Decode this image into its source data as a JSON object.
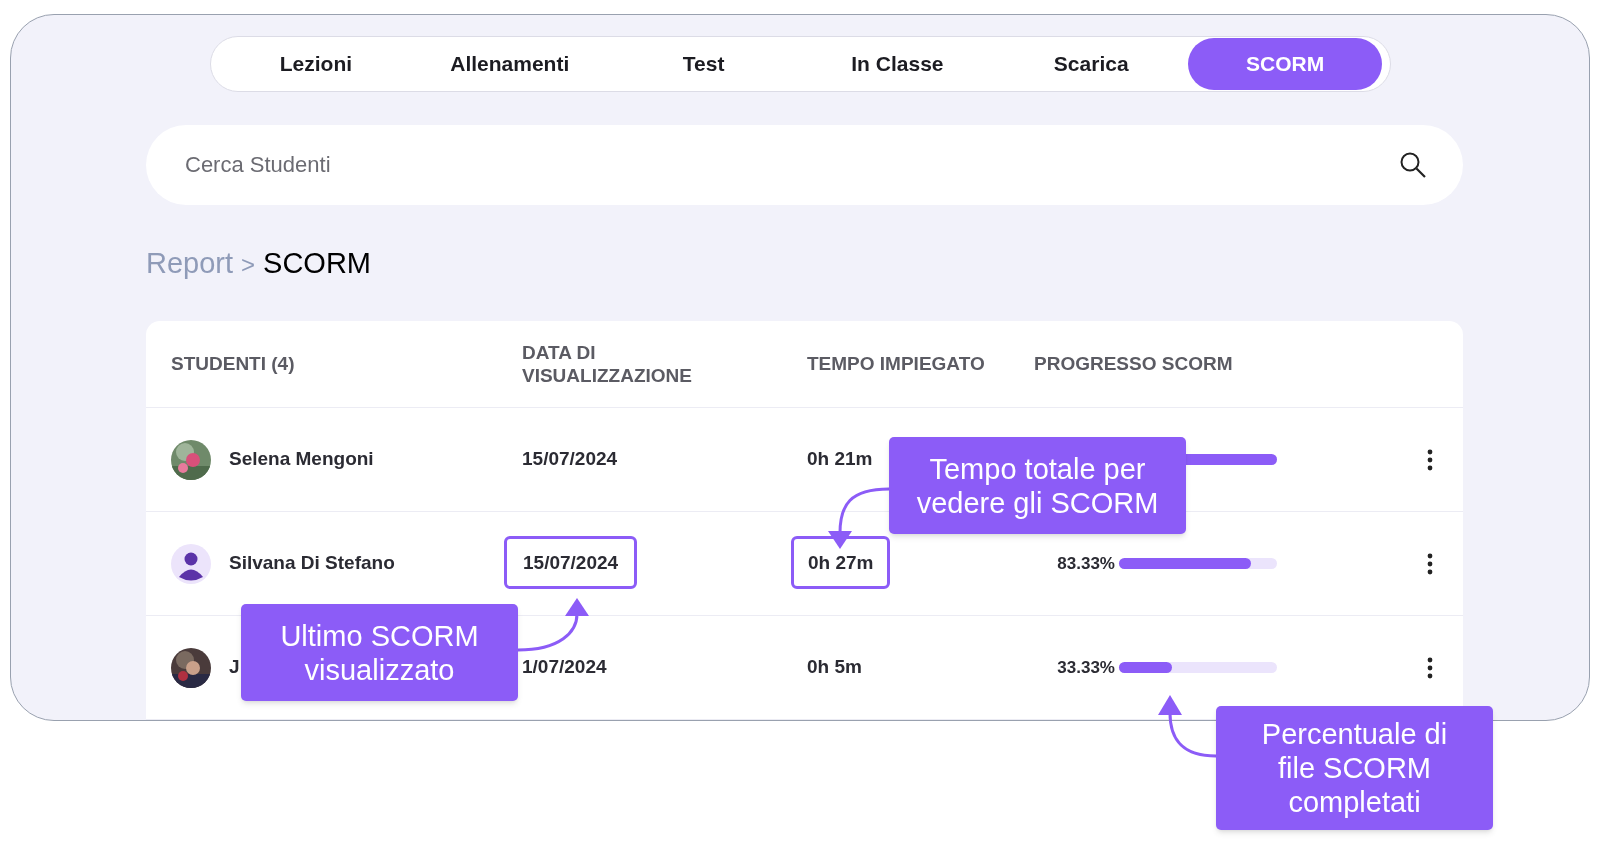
{
  "tabs": [
    {
      "label": "Lezioni",
      "selected": false
    },
    {
      "label": "Allenamenti",
      "selected": false
    },
    {
      "label": "Test",
      "selected": false
    },
    {
      "label": "In Classe",
      "selected": false
    },
    {
      "label": "Scarica",
      "selected": false
    },
    {
      "label": "SCORM",
      "selected": true
    }
  ],
  "search": {
    "placeholder": "Cerca Studenti"
  },
  "breadcrumb": {
    "parent": "Report",
    "separator": ">",
    "current": "SCORM"
  },
  "table": {
    "columns": [
      "STUDENTI (4)",
      "DATA DI VISUALIZZAZIONE",
      "TEMPO IMPIEGATO",
      "PROGRESSO SCORM"
    ],
    "rows": [
      {
        "name": "Selena Mengoni",
        "date": "15/07/2024",
        "date_highlighted": false,
        "time": "0h 21m",
        "time_highlighted": false,
        "level": 1
      },
      {
        "kind": "silhouette",
        "name": "Silvana Di Stefano",
        "date": "15/07/2024",
        "date_highlighted": true,
        "time": "0h 27m",
        "time_highlighted": true,
        "percent": "83.33%",
        "level": 0.8333
      },
      {
        "name": "J",
        "date": "1/07/2024",
        "date_highlighted": false,
        "time": "0h 5m",
        "time_highlighted": false,
        "percent": "33.33%",
        "level": 0.3333
      }
    ]
  },
  "callouts": [
    {
      "text": "Tempo totale per vedere gli SCORM",
      "kind": "time"
    },
    {
      "text": "Ultimo SCORM visualizzato",
      "kind": "date"
    },
    {
      "text": "Percentuale di file SCORM completati",
      "kind": "progress"
    }
  ]
}
